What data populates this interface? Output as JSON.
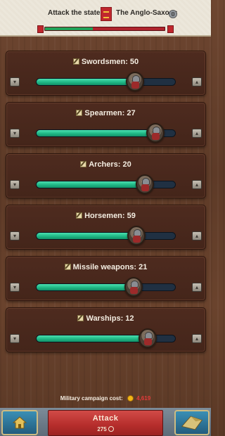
{
  "header": {
    "left_title": "Attack the state",
    "right_title": "The Anglo-Saxons",
    "balance_fraction": 0.4
  },
  "units": [
    {
      "name": "Swordsmen",
      "count": 50,
      "label": "Swordsmen: 50",
      "fill": 0.71
    },
    {
      "name": "Spearmen",
      "count": 27,
      "label": "Spearmen: 27",
      "fill": 0.86
    },
    {
      "name": "Archers",
      "count": 20,
      "label": "Archers: 20",
      "fill": 0.78
    },
    {
      "name": "Horsemen",
      "count": 59,
      "label": "Horsemen: 59",
      "fill": 0.72
    },
    {
      "name": "Missile weapons",
      "count": 21,
      "label": "Missile weapons: 21",
      "fill": 0.7
    },
    {
      "name": "Warships",
      "count": 12,
      "label": "Warships: 12",
      "fill": 0.8
    }
  ],
  "footer": {
    "cost_label": "Military campaign cost:",
    "cost_value": "4,619",
    "attack_label": "Attack",
    "attack_time": "275"
  },
  "icons": {
    "edit": "pencil-icon",
    "minus": "arrow-down-icon",
    "plus": "arrow-up-icon",
    "coin": "coin-icon",
    "home": "home-icon"
  },
  "colors": {
    "slider_fill": "#1fb785",
    "attack_button": "#b52d2b",
    "cost_value": "#e53b3b"
  }
}
